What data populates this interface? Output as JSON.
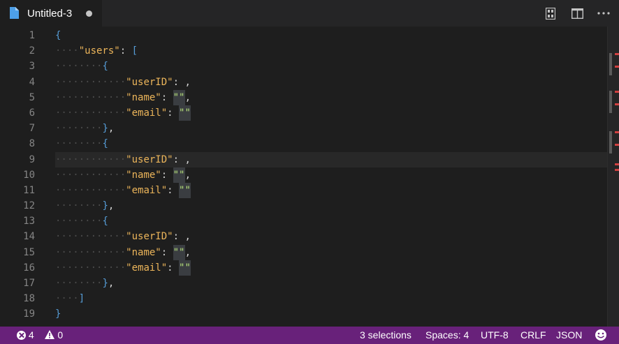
{
  "tab": {
    "title": "Untitled-3",
    "dirty": true,
    "icon": "file-icon",
    "actions": [
      {
        "name": "open-preview-icon"
      },
      {
        "name": "split-editor-icon"
      },
      {
        "name": "more-actions-icon"
      }
    ]
  },
  "editor": {
    "current_line": 9,
    "lines": [
      {
        "n": "1",
        "ws": "",
        "tokens": [
          {
            "t": "{",
            "c": "br"
          }
        ]
      },
      {
        "n": "2",
        "ws": "····",
        "tokens": [
          {
            "t": "\"users\"",
            "c": "key"
          },
          {
            "t": ": ",
            "c": "punc"
          },
          {
            "t": "[",
            "c": "br"
          }
        ]
      },
      {
        "n": "3",
        "ws": "········",
        "tokens": [
          {
            "t": "{",
            "c": "br"
          }
        ]
      },
      {
        "n": "4",
        "ws": "············",
        "tokens": [
          {
            "t": "\"userID\"",
            "c": "key"
          },
          {
            "t": ": ",
            "c": "punc"
          },
          {
            "t": ",",
            "c": "punc"
          }
        ],
        "squiggle": true
      },
      {
        "n": "5",
        "ws": "············",
        "tokens": [
          {
            "t": "\"name\"",
            "c": "key"
          },
          {
            "t": ": ",
            "c": "punc"
          },
          {
            "t": "\"\"",
            "c": "sel"
          },
          {
            "t": ",",
            "c": "punc"
          }
        ]
      },
      {
        "n": "6",
        "ws": "············",
        "tokens": [
          {
            "t": "\"email\"",
            "c": "key"
          },
          {
            "t": ": ",
            "c": "punc"
          },
          {
            "t": "\"\"",
            "c": "sel"
          }
        ]
      },
      {
        "n": "7",
        "ws": "········",
        "tokens": [
          {
            "t": "}",
            "c": "br"
          },
          {
            "t": ",",
            "c": "punc"
          }
        ]
      },
      {
        "n": "8",
        "ws": "········",
        "tokens": [
          {
            "t": "{",
            "c": "br"
          }
        ]
      },
      {
        "n": "9",
        "ws": "············",
        "tokens": [
          {
            "t": "\"userID\"",
            "c": "key"
          },
          {
            "t": ": ",
            "c": "punc"
          },
          {
            "t": ",",
            "c": "punc"
          }
        ],
        "squiggle": true
      },
      {
        "n": "10",
        "ws": "············",
        "tokens": [
          {
            "t": "\"name\"",
            "c": "key"
          },
          {
            "t": ": ",
            "c": "punc"
          },
          {
            "t": "\"\"",
            "c": "sel"
          },
          {
            "t": ",",
            "c": "punc"
          }
        ]
      },
      {
        "n": "11",
        "ws": "············",
        "tokens": [
          {
            "t": "\"email\"",
            "c": "key"
          },
          {
            "t": ": ",
            "c": "punc"
          },
          {
            "t": "\"\"",
            "c": "sel"
          }
        ]
      },
      {
        "n": "12",
        "ws": "········",
        "tokens": [
          {
            "t": "}",
            "c": "br"
          },
          {
            "t": ",",
            "c": "punc"
          }
        ]
      },
      {
        "n": "13",
        "ws": "········",
        "tokens": [
          {
            "t": "{",
            "c": "br"
          }
        ]
      },
      {
        "n": "14",
        "ws": "············",
        "tokens": [
          {
            "t": "\"userID\"",
            "c": "key"
          },
          {
            "t": ": ",
            "c": "punc"
          },
          {
            "t": ",",
            "c": "punc"
          }
        ],
        "squiggle": true
      },
      {
        "n": "15",
        "ws": "············",
        "tokens": [
          {
            "t": "\"name\"",
            "c": "key"
          },
          {
            "t": ": ",
            "c": "punc"
          },
          {
            "t": "\"\"",
            "c": "sel"
          },
          {
            "t": ",",
            "c": "punc"
          }
        ]
      },
      {
        "n": "16",
        "ws": "············",
        "tokens": [
          {
            "t": "\"email\"",
            "c": "key"
          },
          {
            "t": ": ",
            "c": "punc"
          },
          {
            "t": "\"\"",
            "c": "sel"
          }
        ]
      },
      {
        "n": "17",
        "ws": "········",
        "tokens": [
          {
            "t": "}",
            "c": "br"
          },
          {
            "t": ",",
            "c": "punc"
          }
        ]
      },
      {
        "n": "18",
        "ws": "····",
        "tokens": [
          {
            "t": "]",
            "c": "br"
          }
        ],
        "squiggle": true
      },
      {
        "n": "19",
        "ws": "",
        "tokens": [
          {
            "t": "}",
            "c": "br"
          }
        ]
      }
    ]
  },
  "status": {
    "errors": "4",
    "warnings": "0",
    "selections": "3 selections",
    "spaces": "Spaces: 4",
    "encoding": "UTF-8",
    "eol": "CRLF",
    "language": "JSON",
    "feedback_icon": "smiley-icon"
  },
  "colors": {
    "statusbar": "#68217a",
    "editor_bg": "#1e1e1e",
    "key": "#ecb55a",
    "bracket": "#569cd6",
    "error": "#d04040"
  }
}
